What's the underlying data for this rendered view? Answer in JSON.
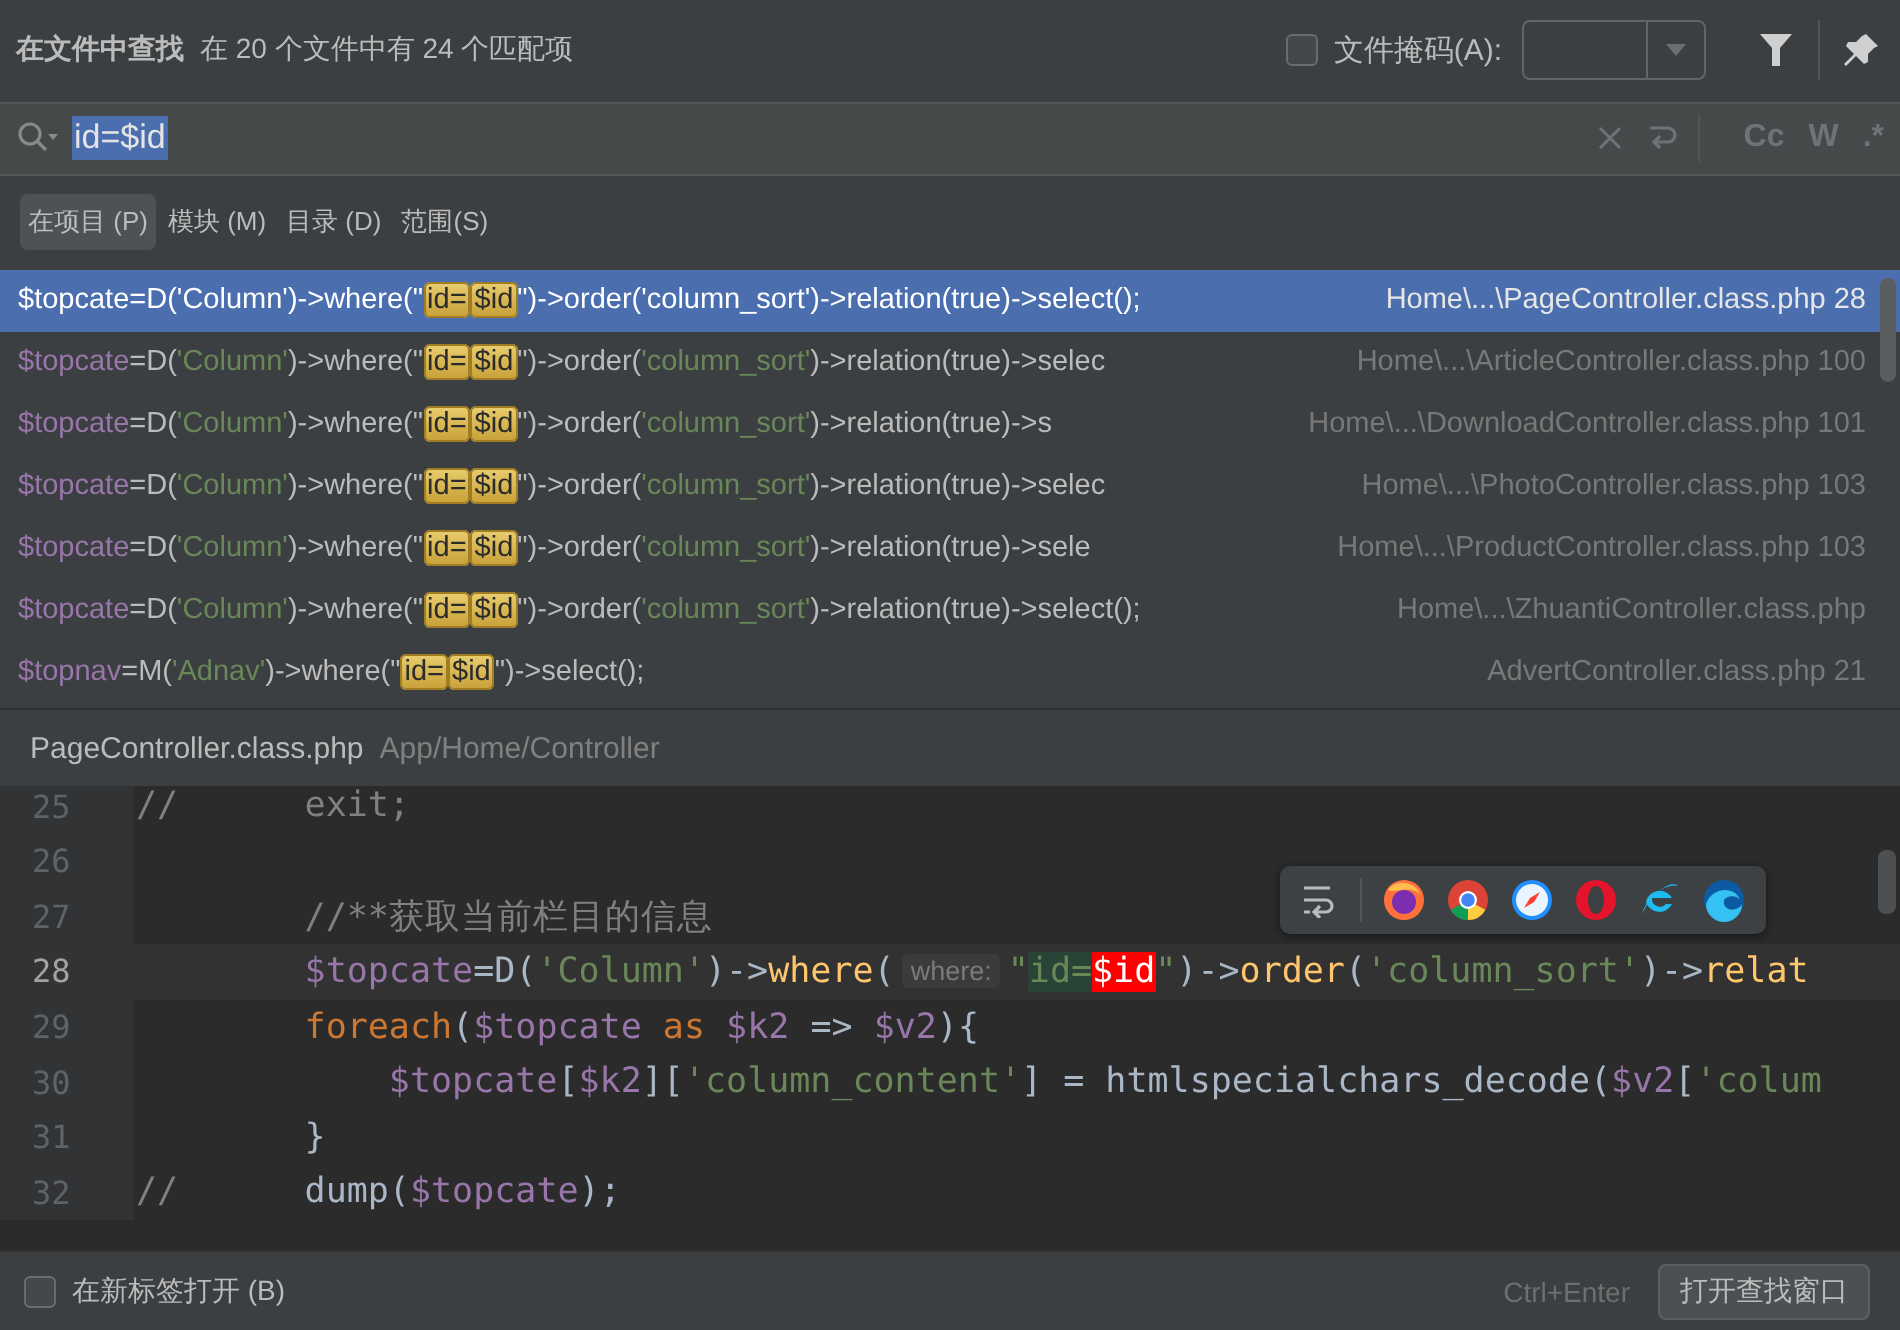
{
  "header": {
    "title": "在文件中查找",
    "summary": "在 20 个文件中有 24 个匹配项",
    "file_mask": {
      "label": "文件掩码(A):",
      "checked": false
    }
  },
  "search": {
    "value": "id=$id",
    "toggles": [
      "Cc",
      "W",
      ".*"
    ]
  },
  "scopes": [
    {
      "label": "在项目 (P)",
      "selected": true
    },
    {
      "label": "模块 (M)",
      "selected": false
    },
    {
      "label": "目录 (D)",
      "selected": false
    },
    {
      "label": "范围(S)",
      "selected": false
    }
  ],
  "results": [
    {
      "selected": true,
      "code": [
        {
          "kind": "var",
          "text": "$topcate"
        },
        {
          "kind": "plain",
          "text": "=D("
        },
        {
          "kind": "str",
          "text": "'Column'"
        },
        {
          "kind": "plain",
          "text": ")->where(\""
        },
        {
          "kind": "match",
          "text": "id="
        },
        {
          "kind": "match",
          "text": "$id"
        },
        {
          "kind": "plain",
          "text": "\")->order("
        },
        {
          "kind": "str",
          "text": "'column_sort'"
        },
        {
          "kind": "plain",
          "text": ")->relation(true)->select();"
        }
      ],
      "location": "Home\\...\\PageController.class.php 28"
    },
    {
      "selected": false,
      "code": [
        {
          "kind": "var",
          "text": "$topcate"
        },
        {
          "kind": "plain",
          "text": "=D("
        },
        {
          "kind": "str",
          "text": "'Column'"
        },
        {
          "kind": "plain",
          "text": ")->where(\""
        },
        {
          "kind": "match",
          "text": "id="
        },
        {
          "kind": "match",
          "text": "$id"
        },
        {
          "kind": "plain",
          "text": "\")->order("
        },
        {
          "kind": "str",
          "text": "'column_sort'"
        },
        {
          "kind": "plain",
          "text": ")->relation(true)->selec"
        }
      ],
      "location": "Home\\...\\ArticleController.class.php 100"
    },
    {
      "selected": false,
      "code": [
        {
          "kind": "var",
          "text": "$topcate"
        },
        {
          "kind": "plain",
          "text": "=D("
        },
        {
          "kind": "str",
          "text": "'Column'"
        },
        {
          "kind": "plain",
          "text": ")->where(\""
        },
        {
          "kind": "match",
          "text": "id="
        },
        {
          "kind": "match",
          "text": "$id"
        },
        {
          "kind": "plain",
          "text": "\")->order("
        },
        {
          "kind": "str",
          "text": "'column_sort'"
        },
        {
          "kind": "plain",
          "text": ")->relation(true)->s"
        }
      ],
      "location": "Home\\...\\DownloadController.class.php 101"
    },
    {
      "selected": false,
      "code": [
        {
          "kind": "var",
          "text": "$topcate"
        },
        {
          "kind": "plain",
          "text": "=D("
        },
        {
          "kind": "str",
          "text": "'Column'"
        },
        {
          "kind": "plain",
          "text": ")->where(\""
        },
        {
          "kind": "match",
          "text": "id="
        },
        {
          "kind": "match",
          "text": "$id"
        },
        {
          "kind": "plain",
          "text": "\")->order("
        },
        {
          "kind": "str",
          "text": "'column_sort'"
        },
        {
          "kind": "plain",
          "text": ")->relation(true)->selec"
        }
      ],
      "location": "Home\\...\\PhotoController.class.php 103"
    },
    {
      "selected": false,
      "code": [
        {
          "kind": "var",
          "text": "$topcate"
        },
        {
          "kind": "plain",
          "text": "=D("
        },
        {
          "kind": "str",
          "text": "'Column'"
        },
        {
          "kind": "plain",
          "text": ")->where(\""
        },
        {
          "kind": "match",
          "text": "id="
        },
        {
          "kind": "match",
          "text": "$id"
        },
        {
          "kind": "plain",
          "text": "\")->order("
        },
        {
          "kind": "str",
          "text": "'column_sort'"
        },
        {
          "kind": "plain",
          "text": ")->relation(true)->sele"
        }
      ],
      "location": "Home\\...\\ProductController.class.php 103"
    },
    {
      "selected": false,
      "code": [
        {
          "kind": "var",
          "text": "$topcate"
        },
        {
          "kind": "plain",
          "text": "=D("
        },
        {
          "kind": "str",
          "text": "'Column'"
        },
        {
          "kind": "plain",
          "text": ")->where(\""
        },
        {
          "kind": "match",
          "text": "id="
        },
        {
          "kind": "match",
          "text": "$id"
        },
        {
          "kind": "plain",
          "text": "\")->order("
        },
        {
          "kind": "str",
          "text": "'column_sort'"
        },
        {
          "kind": "plain",
          "text": ")->relation(true)->select();"
        }
      ],
      "location": "Home\\...\\ZhuantiController.class.php"
    },
    {
      "selected": false,
      "code": [
        {
          "kind": "var",
          "text": "$topnav"
        },
        {
          "kind": "plain",
          "text": "=M("
        },
        {
          "kind": "str",
          "text": "'Adnav'"
        },
        {
          "kind": "plain",
          "text": ")->where(\""
        },
        {
          "kind": "match",
          "text": "id="
        },
        {
          "kind": "match",
          "text": "$id"
        },
        {
          "kind": "plain",
          "text": "\")->select();"
        }
      ],
      "location": "AdvertController.class.php 21"
    }
  ],
  "preview": {
    "file": "PageController.class.php",
    "path": "App/Home/Controller"
  },
  "editor": {
    "lines": [
      {
        "number": "25",
        "current": false,
        "tokens": [
          {
            "kind": "comment",
            "text": "//      exit;"
          }
        ]
      },
      {
        "number": "26",
        "current": false
      },
      {
        "number": "27",
        "current": false,
        "tokens": [
          {
            "kind": "comment",
            "text": "        //**获取当前栏目的信息"
          }
        ]
      },
      {
        "number": "28",
        "current": true,
        "tokens": [
          {
            "kind": "var",
            "text": "        $topcate"
          },
          {
            "kind": "plain",
            "text": "=D("
          },
          {
            "kind": "str",
            "text": "'Column'"
          },
          {
            "kind": "plain",
            "text": ")->"
          },
          {
            "kind": "fn",
            "text": "where"
          },
          {
            "kind": "plain",
            "text": "("
          },
          {
            "kind": "hint",
            "text": "where:"
          },
          {
            "kind": "str",
            "text": "\""
          },
          {
            "kind": "ok",
            "text": "id="
          },
          {
            "kind": "err",
            "text": "$id"
          },
          {
            "kind": "str",
            "text": "\""
          },
          {
            "kind": "plain",
            "text": ")->"
          },
          {
            "kind": "fn",
            "text": "order"
          },
          {
            "kind": "plain",
            "text": "("
          },
          {
            "kind": "str",
            "text": "'column_sort'"
          },
          {
            "kind": "plain",
            "text": ")->"
          },
          {
            "kind": "fn",
            "text": "relat"
          }
        ]
      },
      {
        "number": "29",
        "current": false,
        "tokens": [
          {
            "kind": "kw",
            "text": "        foreach"
          },
          {
            "kind": "plain",
            "text": "("
          },
          {
            "kind": "var",
            "text": "$topcate"
          },
          {
            "kind": "kw",
            "text": " as "
          },
          {
            "kind": "var",
            "text": "$k2"
          },
          {
            "kind": "plain",
            "text": " => "
          },
          {
            "kind": "var",
            "text": "$v2"
          },
          {
            "kind": "plain",
            "text": "){"
          }
        ]
      },
      {
        "number": "30",
        "current": false,
        "tokens": [
          {
            "kind": "var",
            "text": "            $topcate"
          },
          {
            "kind": "plain",
            "text": "["
          },
          {
            "kind": "var",
            "text": "$k2"
          },
          {
            "kind": "plain",
            "text": "]["
          },
          {
            "kind": "str",
            "text": "'column_content'"
          },
          {
            "kind": "plain",
            "text": "] = htmlspecialchars_decode("
          },
          {
            "kind": "var",
            "text": "$v2"
          },
          {
            "kind": "plain",
            "text": "["
          },
          {
            "kind": "str",
            "text": "'colum"
          }
        ]
      },
      {
        "number": "31",
        "current": false,
        "tokens": [
          {
            "kind": "plain",
            "text": "        }"
          }
        ]
      },
      {
        "number": "32",
        "current": false,
        "tokens": [
          {
            "kind": "comment",
            "text": "//"
          },
          {
            "kind": "plain",
            "text": "      dump("
          },
          {
            "kind": "var",
            "text": "$topcate"
          },
          {
            "kind": "plain",
            "text": ");"
          }
        ]
      }
    ]
  },
  "footer": {
    "new_tab": {
      "label": "在新标签打开 (B)",
      "checked": false
    },
    "shortcut": "Ctrl+Enter",
    "button": "打开查找窗口"
  }
}
